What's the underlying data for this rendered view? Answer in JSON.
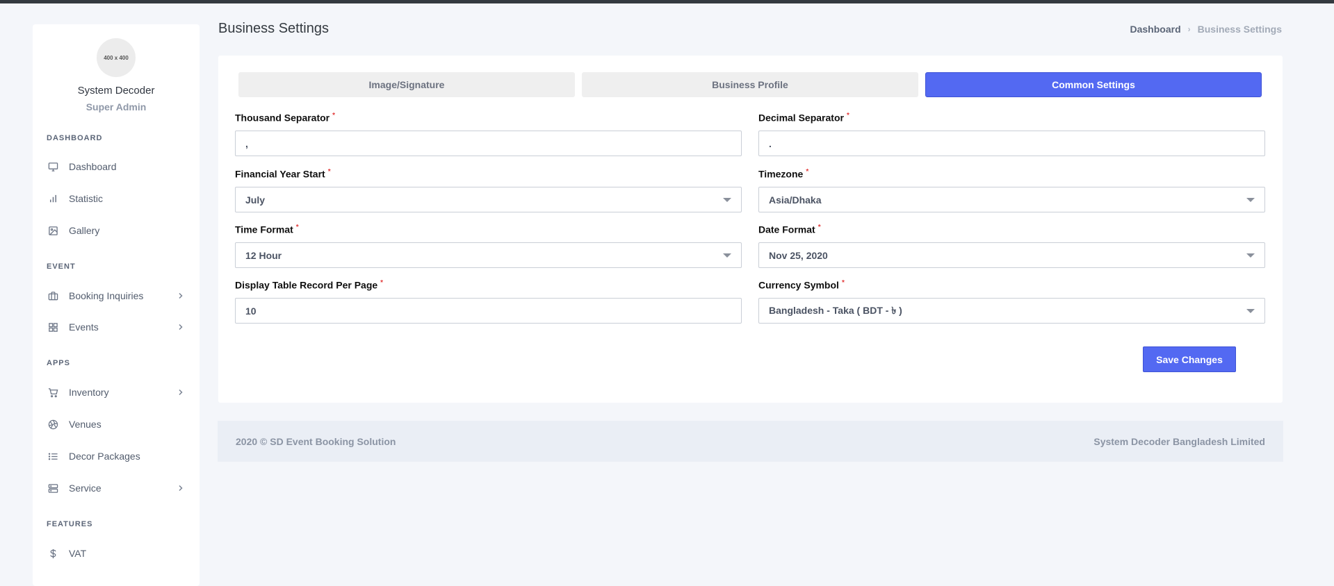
{
  "sidebar": {
    "avatar_text": "400 x 400",
    "user_name": "System Decoder",
    "user_role": "Super Admin",
    "sections": {
      "dashboard": "DASHBOARD",
      "event": "EVENT",
      "apps": "APPS",
      "features": "FEATURES"
    },
    "items": {
      "dashboard": "Dashboard",
      "statistic": "Statistic",
      "gallery": "Gallery",
      "booking_inquiries": "Booking Inquiries",
      "events": "Events",
      "inventory": "Inventory",
      "venues": "Venues",
      "decor_packages": "Decor Packages",
      "service": "Service",
      "vat": "VAT"
    }
  },
  "header": {
    "title": "Business Settings",
    "breadcrumb": {
      "home": "Dashboard",
      "current": "Business Settings"
    }
  },
  "tabs": {
    "image_signature": "Image/Signature",
    "business_profile": "Business Profile",
    "common_settings": "Common Settings"
  },
  "form": {
    "thousand_separator": {
      "label": "Thousand Separator",
      "value": ","
    },
    "decimal_separator": {
      "label": "Decimal Separator",
      "value": "."
    },
    "financial_year_start": {
      "label": "Financial Year Start",
      "value": "July"
    },
    "timezone": {
      "label": "Timezone",
      "value": "Asia/Dhaka"
    },
    "time_format": {
      "label": "Time Format",
      "value": "12 Hour"
    },
    "date_format": {
      "label": "Date Format",
      "value": "Nov 25, 2020"
    },
    "records_per_page": {
      "label": "Display Table Record Per Page",
      "value": "10"
    },
    "currency_symbol": {
      "label": "Currency Symbol",
      "value": "Bangladesh - Taka ( BDT - ৳ )"
    },
    "required_mark": "*",
    "save_label": "Save Changes"
  },
  "footer": {
    "left": "2020 © SD Event Booking Solution",
    "right": "System Decoder Bangladesh Limited"
  },
  "colors": {
    "accent": "#5369f2",
    "required": "#e23b3b",
    "topbar": "#343a40"
  }
}
